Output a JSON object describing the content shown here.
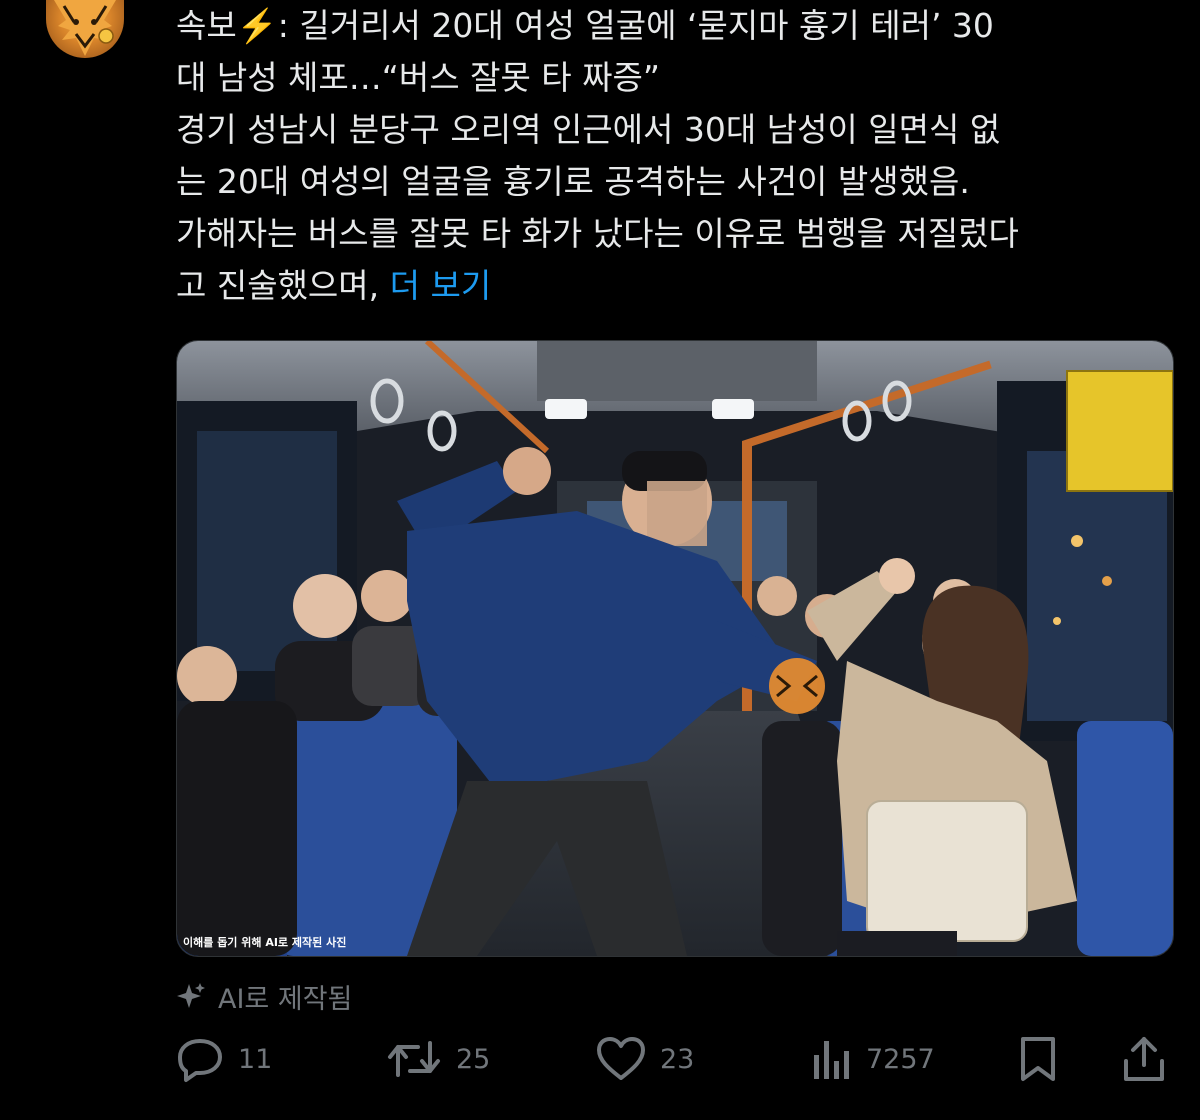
{
  "tweet": {
    "lines": [
      "속보⚡️: 길거리서 20대 여성 얼굴에 ‘묻지마 흉기 테러’ 30",
      "대 남성 체포…“버스 잘못 타 짜증”",
      "경기 성남시 분당구 오리역 인근에서 30대 남성이 일면식 없",
      "는 20대 여성의 얼굴을 흉기로 공격하는 사건이 발생했음.",
      "가해자는 버스를 잘못 타 화가 났다는 이유로 범행을 저질렀다"
    ],
    "last_line": "고 진술했으며, ",
    "show_more": "더 보기"
  },
  "media": {
    "caption": "이해를 돕기 위해 AI로 제작된 사진"
  },
  "ai_label": {
    "icon": "sparkle-icon",
    "text": "AI로 제작됨"
  },
  "actions": {
    "reply": {
      "icon": "reply-icon",
      "count": "11"
    },
    "repost": {
      "icon": "repost-icon",
      "count": "25"
    },
    "like": {
      "icon": "heart-icon",
      "count": "23"
    },
    "views": {
      "icon": "views-icon",
      "count": "7257"
    },
    "bookmark": {
      "icon": "bookmark-icon"
    },
    "share": {
      "icon": "share-icon"
    }
  },
  "colors": {
    "background": "#000000",
    "text": "#e7e9ea",
    "muted": "#71767b",
    "link": "#1d9bf0"
  }
}
